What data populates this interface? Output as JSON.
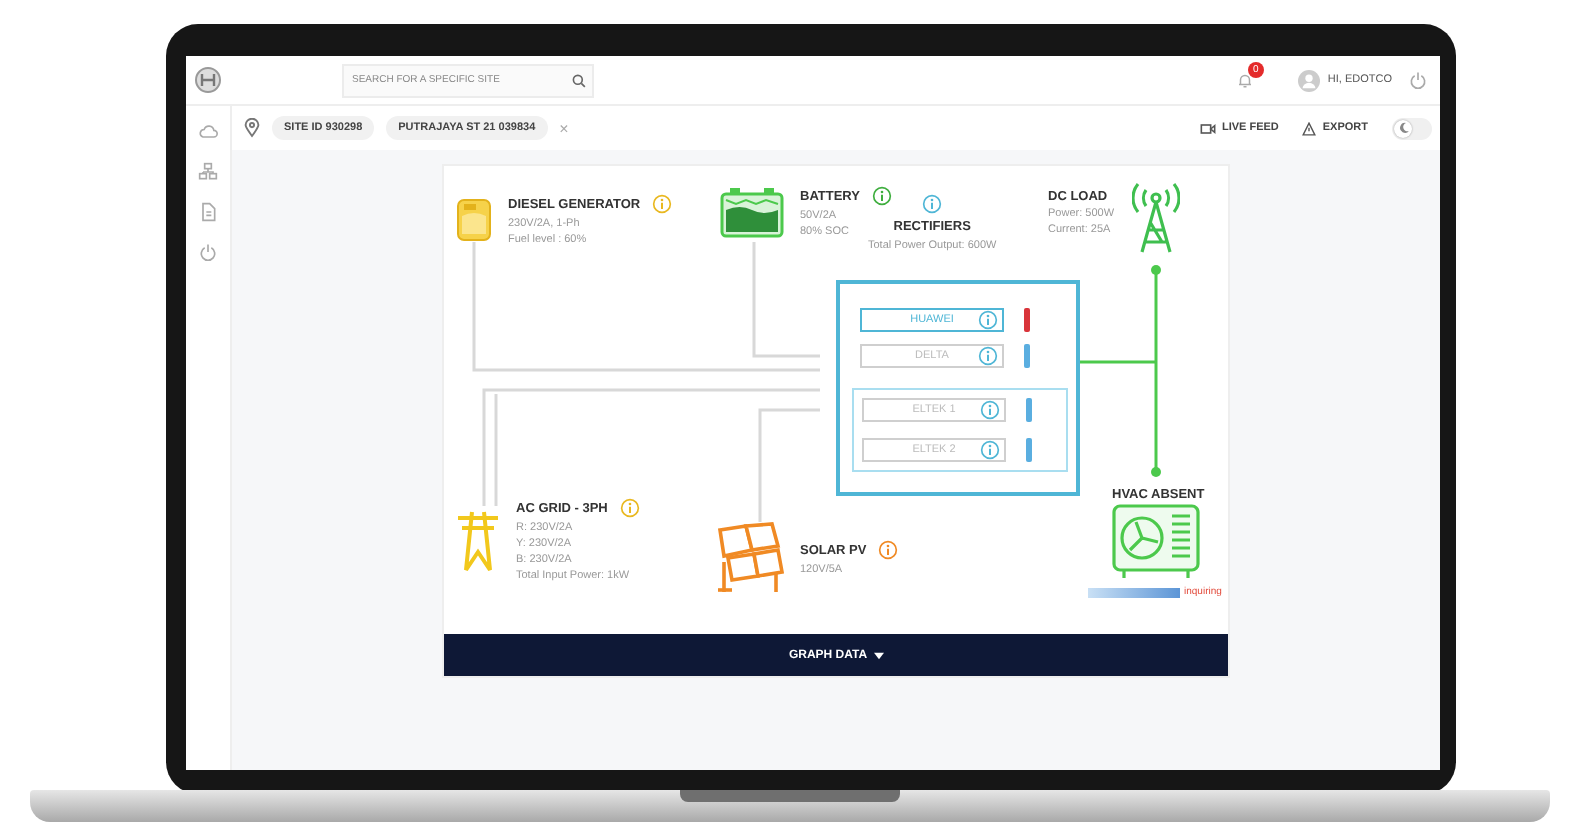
{
  "header": {
    "search": {
      "placeholder": "SEARCH FOR A SPECIFIC SITE"
    },
    "notification_count": "0",
    "user": "HI, EDOTCO"
  },
  "filter_bar": {
    "chips": [
      {
        "label": "SITE ID 930298"
      },
      {
        "label": "PUTRAJAYA ST 21 039834"
      }
    ],
    "clear": "×",
    "actions": [
      {
        "kind": "live_feed",
        "label": "LIVE FEED"
      },
      {
        "kind": "export",
        "label": "EXPORT"
      }
    ],
    "dark_mode": {
      "on": false
    }
  },
  "diagram": {
    "sources": [
      {
        "kind": "diesel",
        "title": "DIESEL GENERATOR",
        "lines": [
          "230V/2A, 1-Ph",
          "Fuel level : 60%"
        ]
      },
      {
        "kind": "battery",
        "title": "BATTERY",
        "lines": [
          "50V/2A",
          "80% SOC"
        ]
      },
      {
        "kind": "ac_grid",
        "title": "AC GRID - 3PH",
        "lines": [
          "R: 230V/2A",
          "Y: 230V/2A",
          "B: 230V/2A",
          "Total Input Power: 1kW"
        ]
      },
      {
        "kind": "solar",
        "title": "SOLAR PV",
        "lines": [
          "120V/5A"
        ]
      }
    ],
    "rectifiers": {
      "title": "RECTIFIERS",
      "summary": "Total Power Output: 600W",
      "groups": [
        {
          "modules": [
            {
              "label": "HUAWEI",
              "active": true,
              "color": "#d9343a"
            },
            {
              "label": "DELTA",
              "active": false,
              "color": "#5aaee0"
            }
          ]
        },
        {
          "modules": [
            {
              "label": "ELTEK 1",
              "active": false,
              "color": "#5aaee0"
            },
            {
              "label": "ELTEK 2",
              "active": false,
              "color": "#5aaee0"
            }
          ]
        }
      ]
    },
    "dc_load": {
      "title": "DC LOAD",
      "lines": [
        "Power: 500W",
        "Current: 25A"
      ]
    },
    "hvac": {
      "title": "HVAC ABSENT",
      "status": "inquiring"
    }
  },
  "graph_button": {
    "label": "GRAPH DATA"
  }
}
